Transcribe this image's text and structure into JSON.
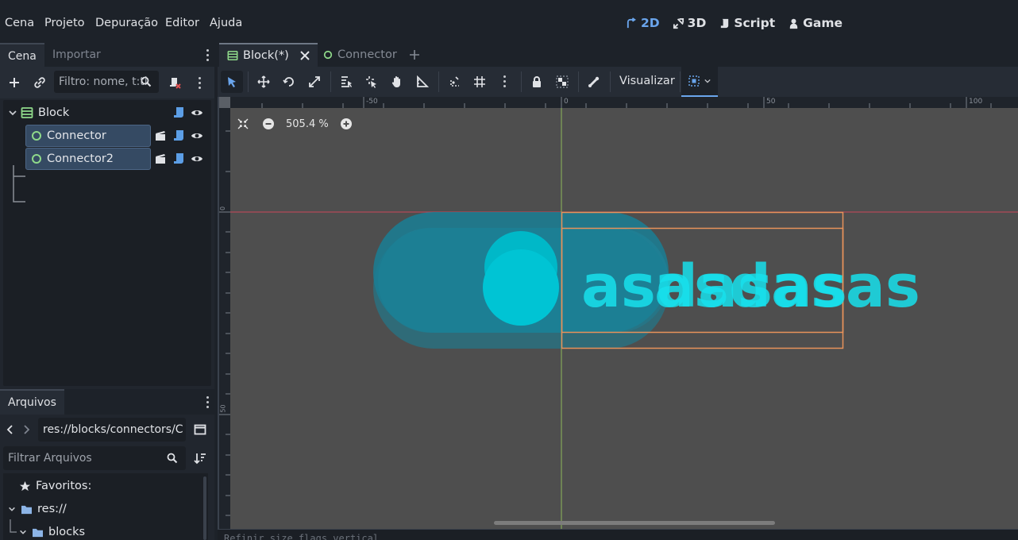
{
  "menu": {
    "items": [
      "Cena",
      "Projeto",
      "Depuração",
      "Editor",
      "Ajuda"
    ]
  },
  "workspaces": {
    "items": [
      "2D",
      "3D",
      "Script",
      "Game"
    ],
    "active": "2D",
    "active_color": "#6aa5ec"
  },
  "scene_dock": {
    "tabs": [
      "Cena",
      "Importar"
    ],
    "filter_placeholder": "Filtro: nome, t:ti",
    "tree": [
      {
        "label": "Block",
        "icon": "control-node-icon",
        "selected": false
      },
      {
        "label": "Connector",
        "icon": "node2d-circle-icon",
        "selected": true
      },
      {
        "label": "Connector2",
        "icon": "node2d-circle-icon",
        "selected": true
      }
    ]
  },
  "file_dock": {
    "tab": "Arquivos",
    "path": "res://blocks/connectors/C",
    "filter_placeholder": "Filtrar Arquivos",
    "tree": [
      {
        "label": "Favoritos:",
        "icon": "star-icon"
      },
      {
        "label": "res://",
        "icon": "folder-icon"
      },
      {
        "label": "blocks",
        "icon": "folder-icon"
      }
    ]
  },
  "editor_tabs": {
    "tabs": [
      {
        "label": "Block(*)",
        "active": true
      },
      {
        "label": "Connector",
        "active": false
      }
    ]
  },
  "editor_toolbar": {
    "view_label": "Visualizar"
  },
  "viewport": {
    "zoom": "505.4 %",
    "ruler_top_labels": [
      "-50",
      "0",
      "50",
      "100"
    ],
    "ruler_left_labels": [
      "0",
      "50"
    ],
    "canvas_text": "asdasas",
    "colors": {
      "background": "#4e4e4e",
      "pill": "#1a7f95",
      "circle": "#00c4d4",
      "text": "#18e0ec",
      "selection": "#e8925a",
      "axis_x": "#c9465a",
      "axis_y": "#8fb85a"
    }
  },
  "output": {
    "text": "Refinir size flags vertical"
  }
}
